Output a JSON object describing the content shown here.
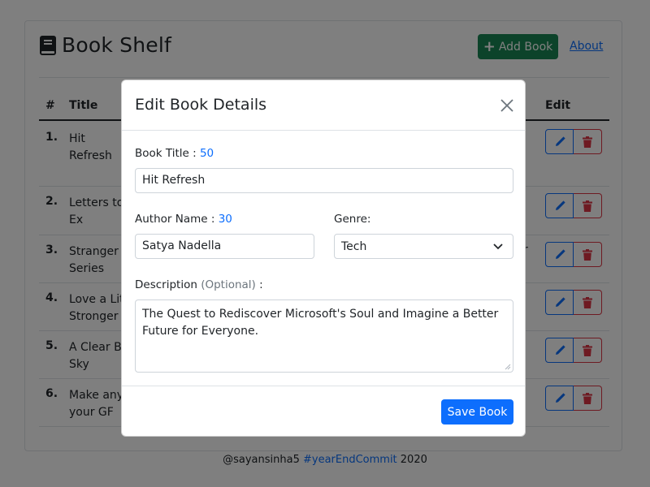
{
  "app": {
    "title": "Book Shelf",
    "add_button_label": "Add Book",
    "about_link": "About"
  },
  "table": {
    "headers": {
      "num": "#",
      "title": "Title",
      "edit": "Edit"
    },
    "rows": [
      {
        "num": "1.",
        "title": "Hit Refresh",
        "extra": ""
      },
      {
        "num": "2.",
        "title": "Letters to Ex",
        "extra": ""
      },
      {
        "num": "3.",
        "title": "Stranger Series",
        "extra": "r"
      },
      {
        "num": "4.",
        "title": "Love a Lit Stronger",
        "extra": ""
      },
      {
        "num": "5.",
        "title": "A Clear Bl Sky",
        "extra": ""
      },
      {
        "num": "6.",
        "title": "Make any your GF",
        "extra": ""
      }
    ]
  },
  "footer": {
    "user": "@sayansinha5 ",
    "hashtag": "#yearEndCommit",
    "year": " 2020"
  },
  "modal": {
    "title": "Edit Book Details",
    "book_title_label": "Book Title : ",
    "book_title_count": "50",
    "book_title_value": "Hit Refresh",
    "author_label": "Author Name : ",
    "author_count": "30",
    "author_value": "Satya Nadella",
    "genre_label": "Genre:",
    "genre_value": "Tech",
    "description_label": "Description ",
    "description_optional": "(Optional)",
    "description_suffix": " :",
    "description_value": "The Quest to Rediscover Microsoft's Soul and Imagine a Better Future for Everyone.",
    "save_label": "Save Book"
  },
  "colors": {
    "primary": "#0d6efd",
    "success": "#198754",
    "danger": "#dc3545",
    "backdrop": "rgba(0,0,0,0.5)"
  },
  "icons": [
    "book-icon",
    "plus-icon",
    "pencil-icon",
    "trash-icon",
    "close-icon",
    "chevron-down-icon"
  ]
}
